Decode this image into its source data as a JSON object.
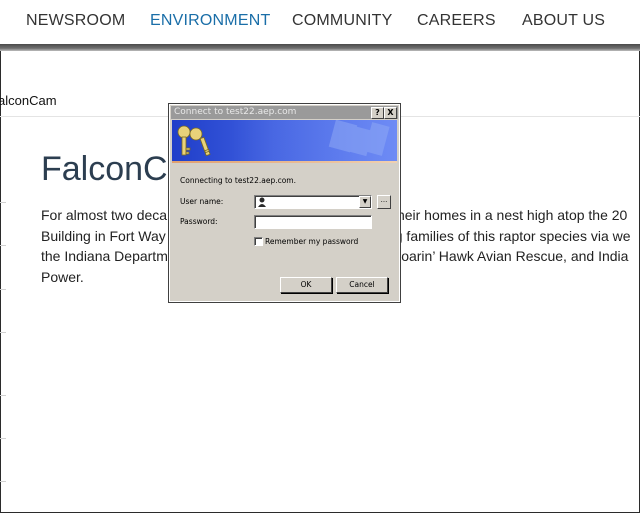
{
  "nav": {
    "items": [
      {
        "label": "NEWSROOM",
        "active": false
      },
      {
        "label": "ENVIRONMENT",
        "active": true
      },
      {
        "label": "COMMUNITY",
        "active": false
      },
      {
        "label": "CAREERS",
        "active": false
      },
      {
        "label": "ABOUT US",
        "active": false
      }
    ],
    "active_color": "#1a6ea8"
  },
  "page": {
    "breadcrumb": "alconCam",
    "title": "FalconCa",
    "paragraph": [
      "For almost two deca",
      "their homes in a nest high atop the 20",
      "Building in Fort Way",
      "g families of this raptor species via we",
      "the Indiana Departm",
      "Soarin’ Hawk Avian Rescue, and India",
      "Power."
    ]
  },
  "dialog": {
    "title": "Connect to test22.aep.com",
    "help_label": "?",
    "close_label": "X",
    "connecting_text": "Connecting to test22.aep.com.",
    "username_label": "User name:",
    "username_value": "",
    "browse_label": "...",
    "password_label": "Password:",
    "password_value": "",
    "remember_label": "Remember my password",
    "remember_checked": false,
    "ok_label": "OK",
    "cancel_label": "Cancel",
    "banner_icon": "keys-icon",
    "user_icon": "user-icon"
  }
}
